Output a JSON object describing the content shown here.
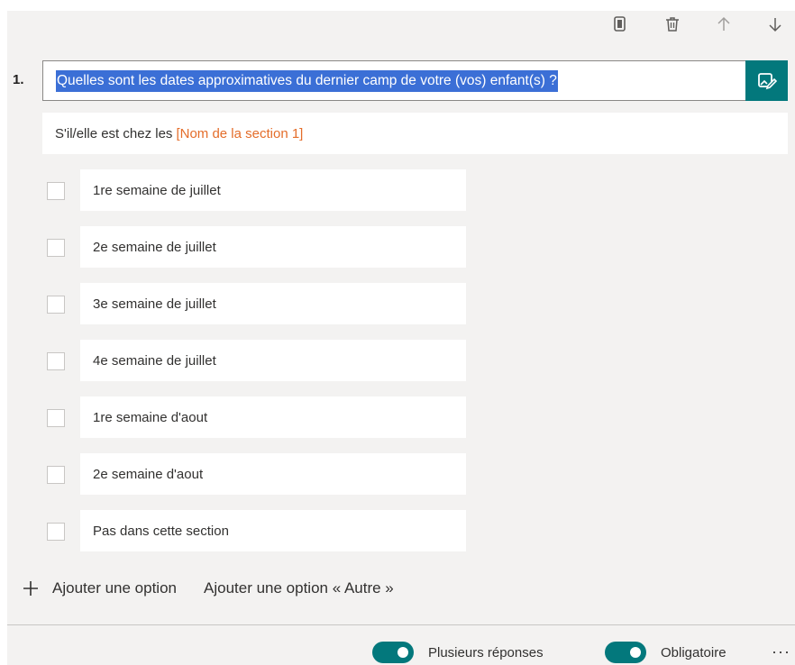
{
  "toolbar": {
    "copy_icon": "copy-icon",
    "delete_icon": "trash-icon",
    "up_icon": "arrow-up-icon",
    "down_icon": "arrow-down-icon"
  },
  "question": {
    "number": "1.",
    "text": "Quelles sont les dates approximatives du dernier camp de votre (vos) enfant(s) ?",
    "subtitle_prefix": "S'il/elle est chez les",
    "subtitle_link": "[Nom de la section 1]"
  },
  "options": [
    {
      "label": "1re semaine de juillet"
    },
    {
      "label": "2e semaine de juillet"
    },
    {
      "label": "3e semaine de juillet"
    },
    {
      "label": "4e semaine de juillet"
    },
    {
      "label": "1re semaine d'aout"
    },
    {
      "label": "2e semaine d'aout"
    },
    {
      "label": "Pas dans cette section"
    }
  ],
  "actions": {
    "add_option": "Ajouter une option",
    "add_other": "Ajouter une option « Autre »"
  },
  "footer": {
    "multiple_label": "Plusieurs réponses",
    "multiple_on": true,
    "required_label": "Obligatoire",
    "required_on": true,
    "more": "···"
  },
  "colors": {
    "accent": "#03787c",
    "highlight": "#3b6fd6",
    "link": "#e46d2a"
  }
}
